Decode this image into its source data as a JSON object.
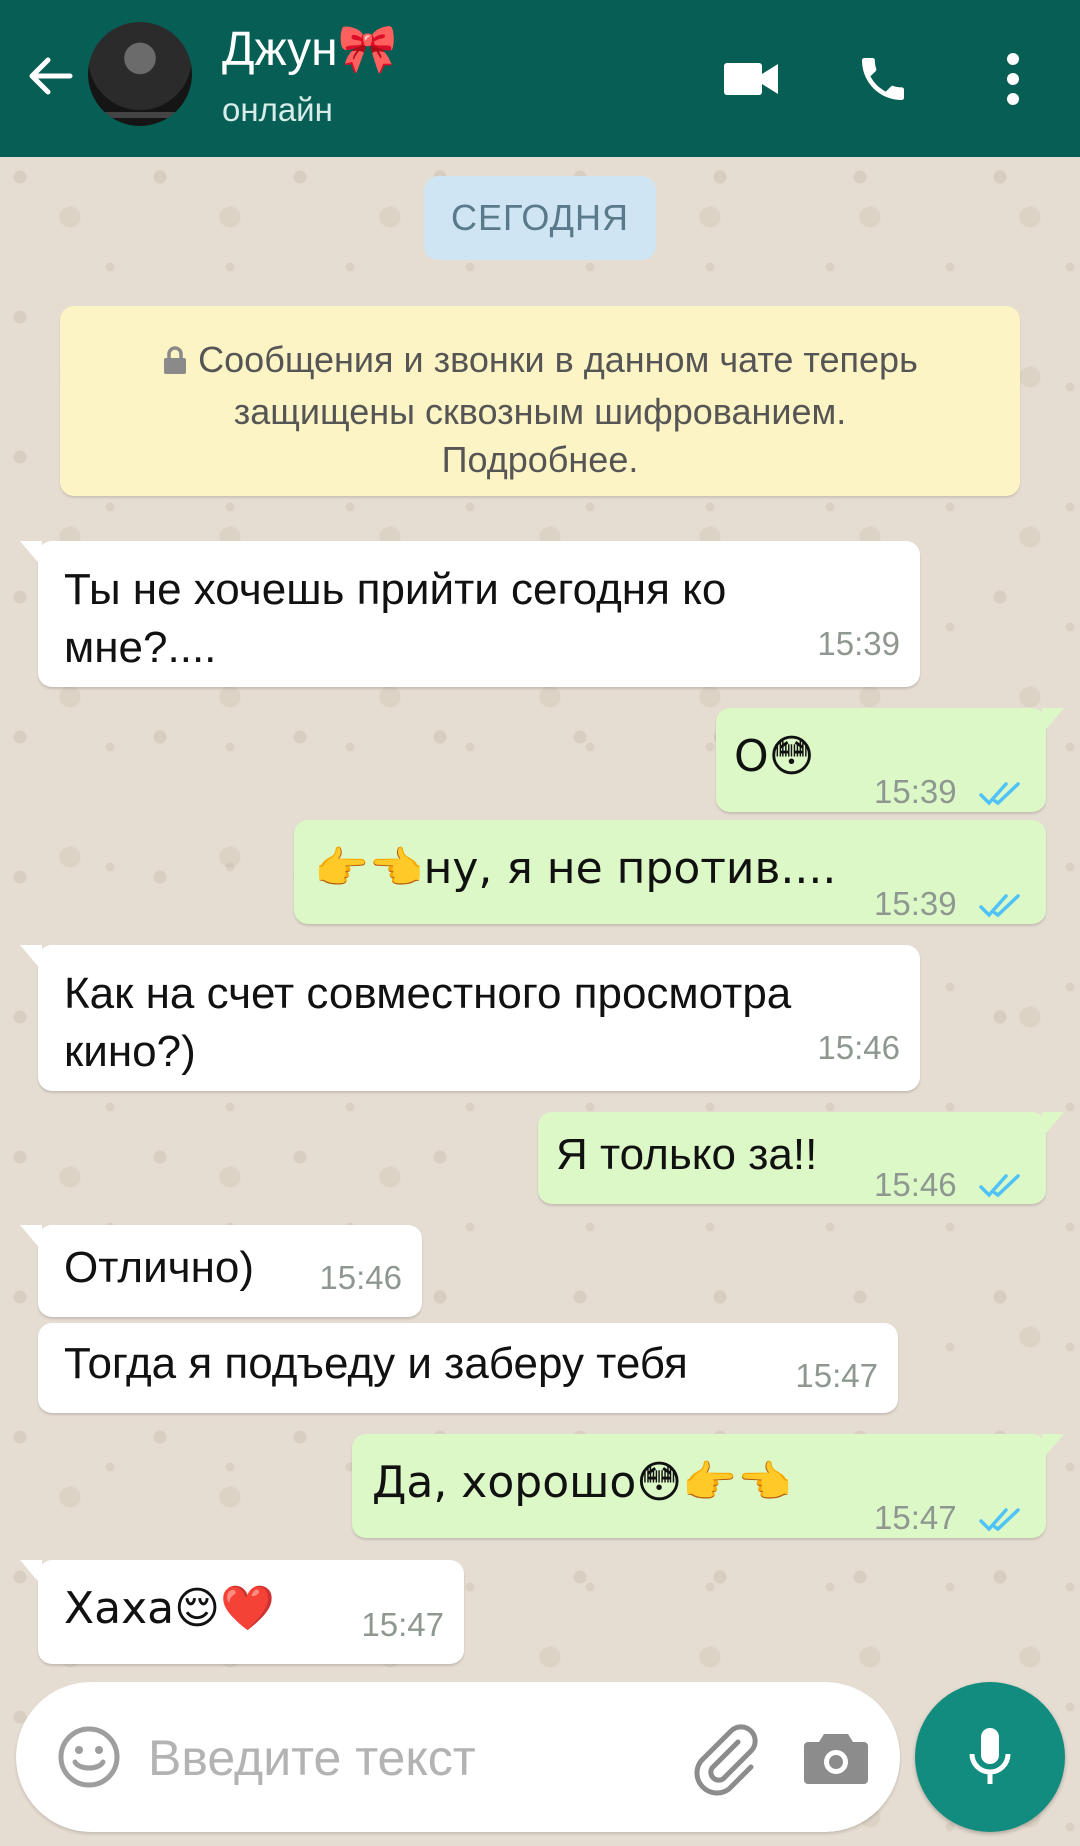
{
  "header": {
    "contact_name": "Джун🎀",
    "status": "онлайн",
    "colors": {
      "bar": "#075e54"
    }
  },
  "chat": {
    "date_chip": "СЕГОДНЯ",
    "encryption_notice": {
      "line1": "Сообщения и звонки в данном чате теперь",
      "line2": "защищены сквозным шифрованием.",
      "line3": "Подробнее."
    },
    "messages": [
      {
        "direction": "in",
        "line1": "Ты не хочешь прийти сегодня ко",
        "line2": "мне?....",
        "time": "15:39"
      },
      {
        "direction": "out",
        "text": "О😳",
        "time": "15:39",
        "status": "read"
      },
      {
        "direction": "out",
        "text": "👉👈ну, я не против....",
        "time": "15:39",
        "status": "read"
      },
      {
        "direction": "in",
        "line1": "Как на счет совместного просмотра",
        "line2": "кино?)",
        "time": "15:46"
      },
      {
        "direction": "out",
        "text": "Я только за!!",
        "time": "15:46",
        "status": "read"
      },
      {
        "direction": "in",
        "text": "Отлично)",
        "time": "15:46"
      },
      {
        "direction": "in",
        "text": "Тогда я подъеду и заберу тебя",
        "time": "15:47"
      },
      {
        "direction": "out",
        "text": "Да, хорошо😳👉👈",
        "time": "15:47",
        "status": "read"
      },
      {
        "direction": "in",
        "text": "Хаха😌❤️",
        "time": "15:47"
      }
    ]
  },
  "composer": {
    "placeholder": "Введите текст"
  },
  "colors": {
    "incoming_bubble": "#ffffff",
    "outgoing_bubble": "#dcf8c6",
    "read_ticks": "#4fc3f7",
    "mic_button": "#128c7e"
  }
}
